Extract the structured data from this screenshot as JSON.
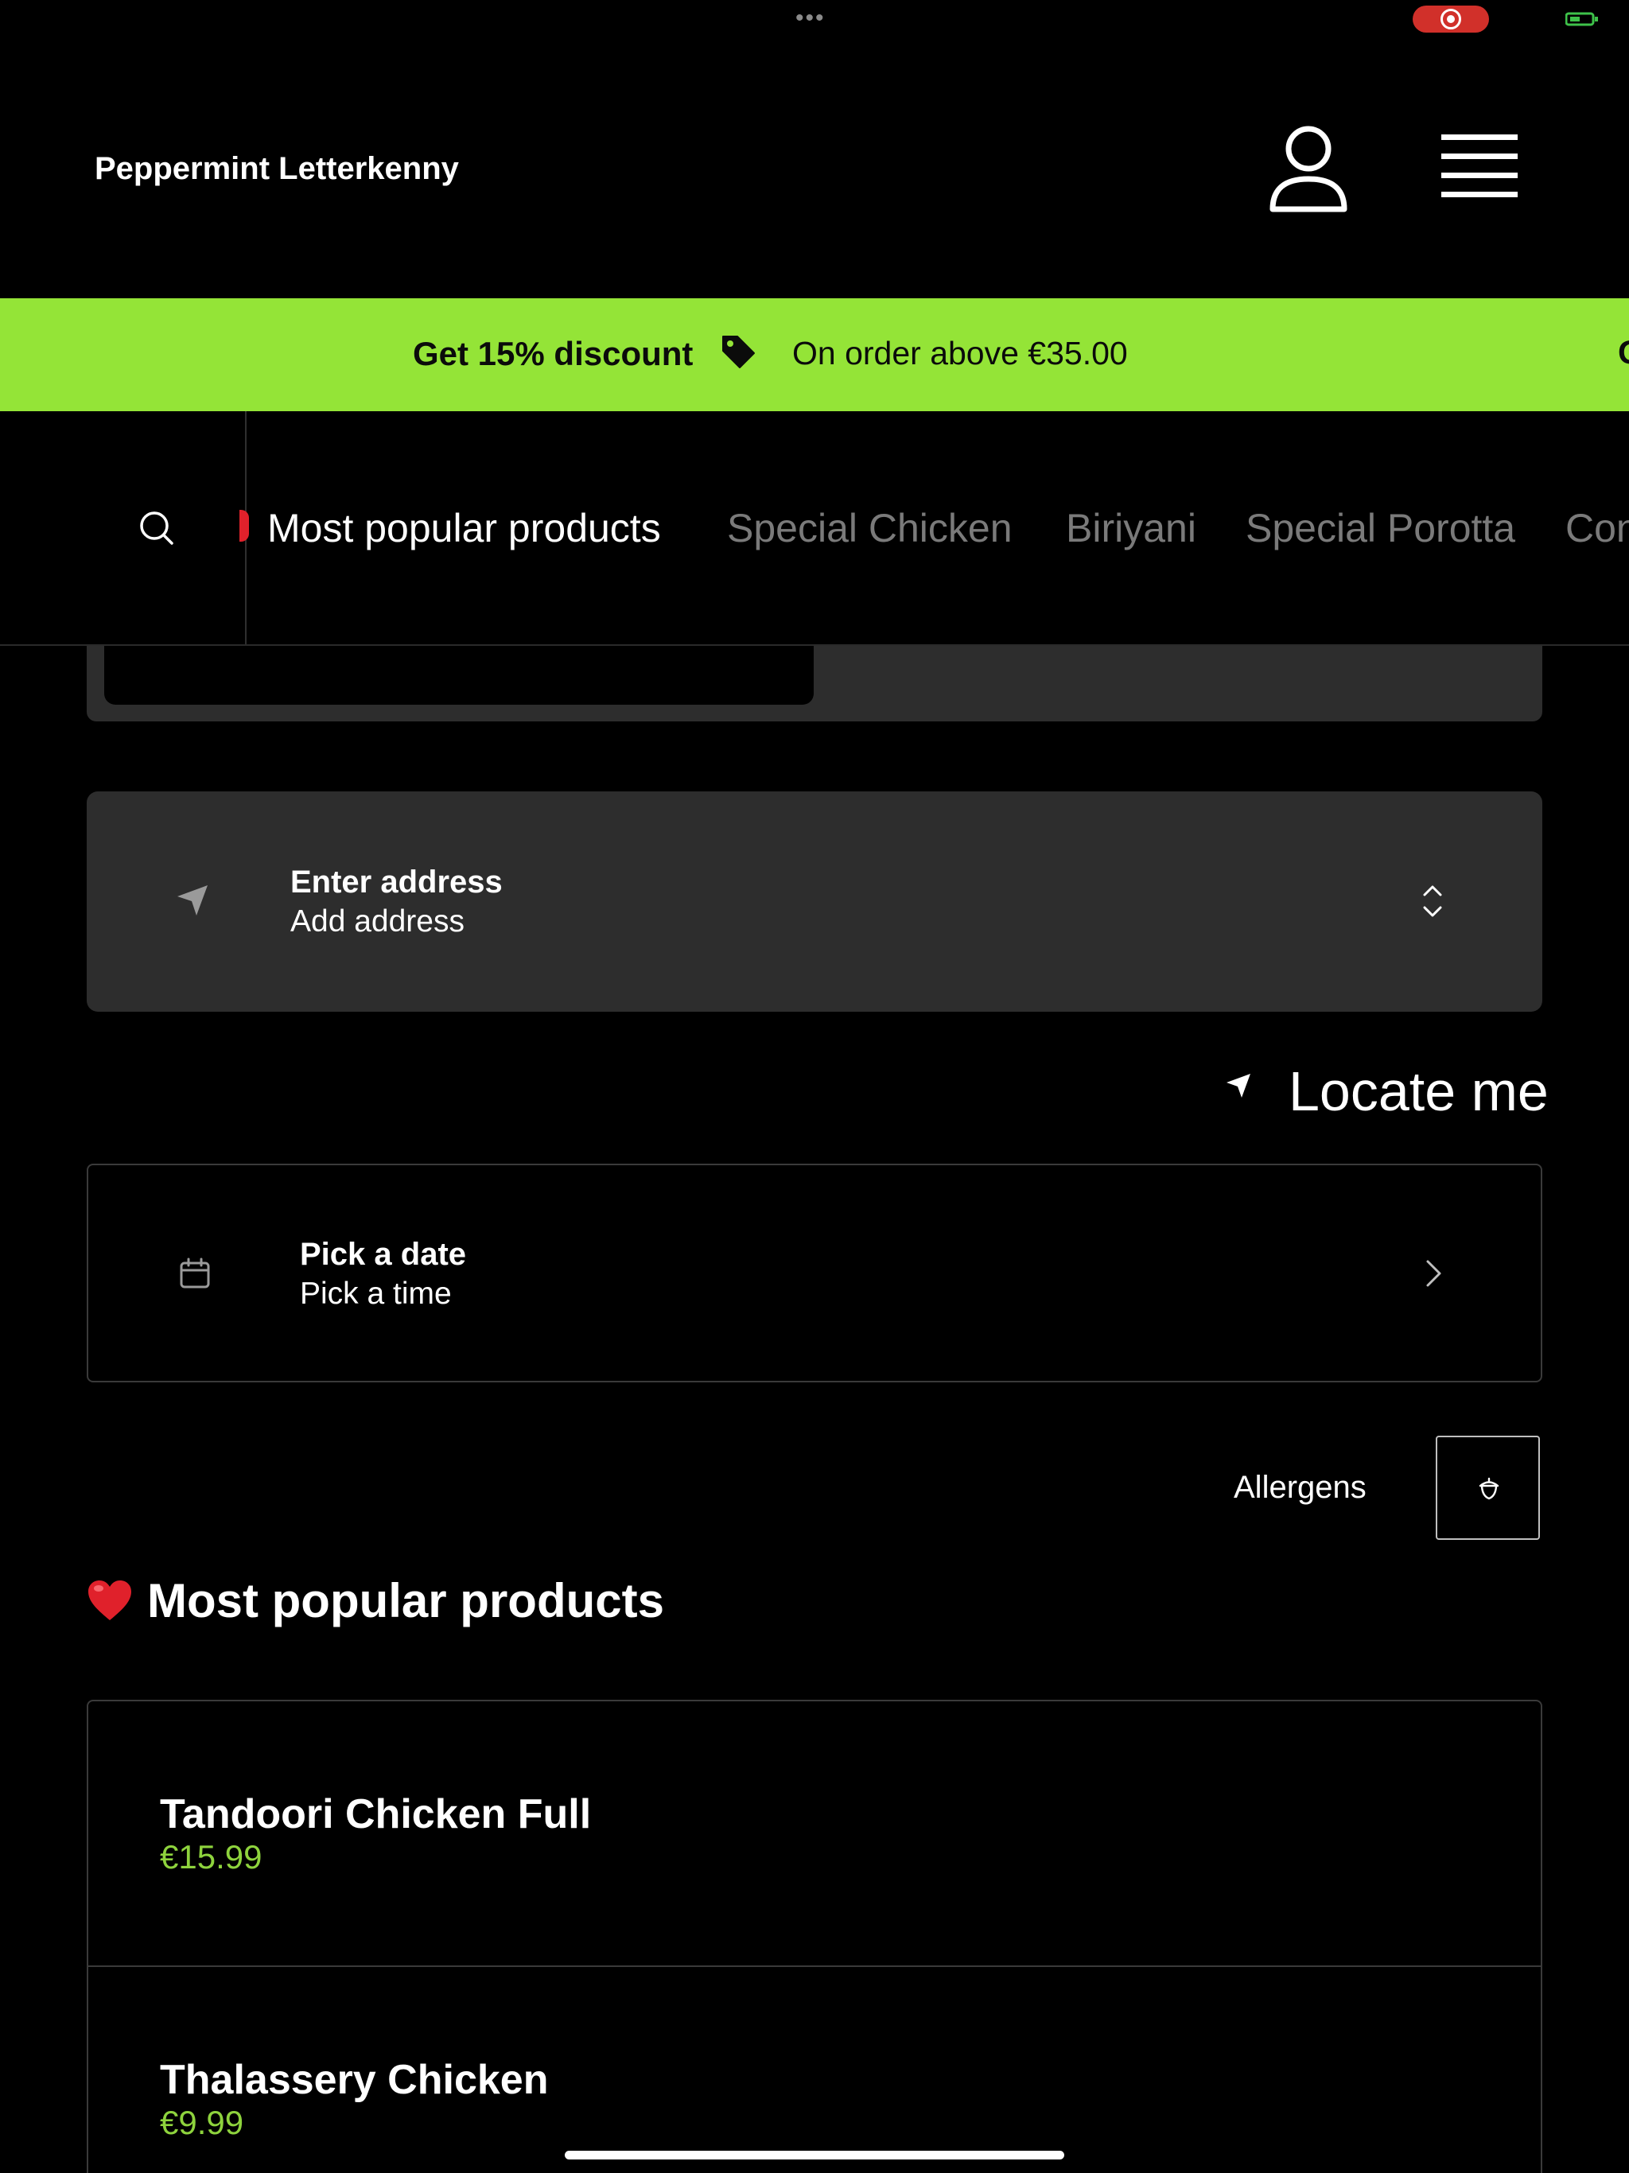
{
  "app": {
    "brand": "Peppermint Letterkenny"
  },
  "promo": {
    "title": "Get 15% discount",
    "subtitle": "On order above €35.00",
    "next_partial": "G",
    "accent_color": "#94e437"
  },
  "categories": {
    "tabs": [
      {
        "label": "Most popular products",
        "active": true
      },
      {
        "label": "Special Chicken",
        "active": false
      },
      {
        "label": "Biriyani",
        "active": false
      },
      {
        "label": "Special Porotta",
        "active": false
      },
      {
        "label": "Con",
        "active": false
      }
    ]
  },
  "address": {
    "title": "Enter address",
    "subtitle": "Add address"
  },
  "locate": {
    "label": "Locate me"
  },
  "schedule": {
    "date_label": "Pick a date",
    "time_label": "Pick a time"
  },
  "allergens": {
    "label": "Allergens"
  },
  "section": {
    "title": "Most popular products"
  },
  "products": [
    {
      "name": "Tandoori Chicken Full",
      "price": "€15.99"
    },
    {
      "name": "Thalassery Chicken",
      "price": "€9.99"
    }
  ],
  "colors": {
    "price": "#8ed33d",
    "card": "#2d2d2d",
    "record": "#d1302a"
  }
}
